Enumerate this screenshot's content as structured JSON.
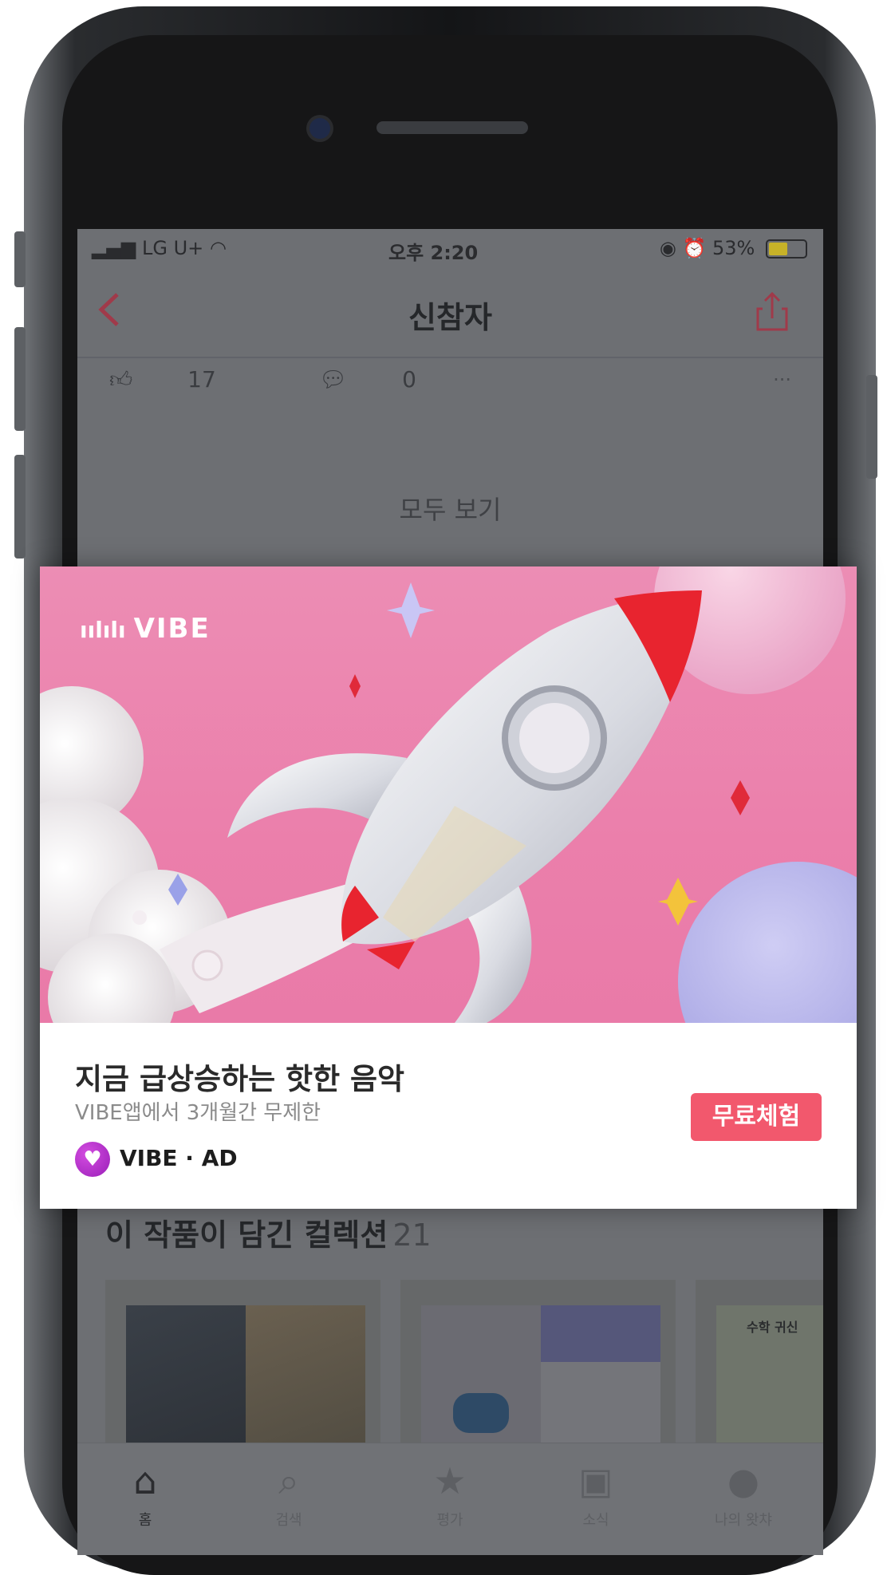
{
  "status_bar": {
    "carrier": "LG U+",
    "time": "오후 2:20",
    "battery": "53%",
    "battery_level": 0.53
  },
  "nav": {
    "back_icon": "chevron-left-icon",
    "title": "신참자",
    "share_icon": "share-icon"
  },
  "meta": {
    "likes": "17",
    "comments": "0",
    "more": "···"
  },
  "see_all": "모두 보기",
  "ad": {
    "brand": "VIBE",
    "title": "지금 급상승하는 핫한 음악",
    "subtitle": "VIBE앱에서 3개월간 무제한",
    "sponsor": "VIBE · AD",
    "cta": "무료체험",
    "accent_color": "#f2586d"
  },
  "collections": {
    "title": "이 작품이 담긴 컬렉션",
    "count": "21",
    "cover_texts": [
      "수학 귀신"
    ]
  },
  "tabbar": {
    "items": [
      {
        "label": "홈",
        "icon": "home-icon"
      },
      {
        "label": "검색",
        "icon": "search-icon"
      },
      {
        "label": "평가",
        "icon": "star-icon"
      },
      {
        "label": "소식",
        "icon": "chat-icon"
      },
      {
        "label": "나의 왓챠",
        "icon": "profile-icon"
      }
    ]
  }
}
